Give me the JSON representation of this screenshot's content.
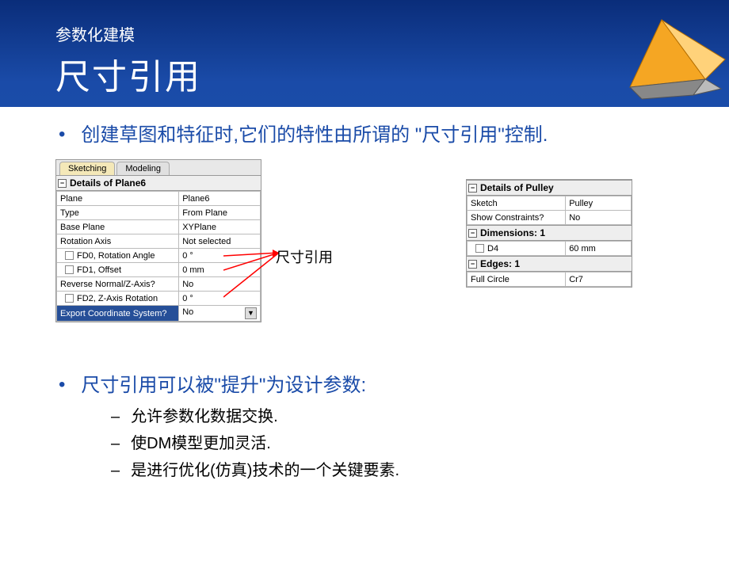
{
  "header": {
    "subtitle": "参数化建模",
    "title": "尺寸引用"
  },
  "bullets": {
    "b1": "创建草图和特征时,它们的特性由所谓的 \"尺寸引用\"控制.",
    "b2": "尺寸引用可以被\"提升\"为设计参数:",
    "sub1": "允许参数化数据交换.",
    "sub2": "使DM模型更加灵活.",
    "sub3": "是进行优化(仿真)技术的一个关键要素."
  },
  "callout": "尺寸引用",
  "panel_left": {
    "tabs": {
      "t1": "Sketching",
      "t2": "Modeling"
    },
    "header": "Details of Plane6",
    "rows": [
      {
        "label": "Plane",
        "value": "Plane6",
        "checkbox": false
      },
      {
        "label": "Type",
        "value": "From Plane",
        "checkbox": false
      },
      {
        "label": "Base Plane",
        "value": "XYPlane",
        "checkbox": false
      },
      {
        "label": "Rotation Axis",
        "value": "Not selected",
        "checkbox": false
      },
      {
        "label": "FD0, Rotation Angle",
        "value": "0 °",
        "checkbox": true
      },
      {
        "label": "FD1, Offset",
        "value": "0 mm",
        "checkbox": true
      },
      {
        "label": "Reverse Normal/Z-Axis?",
        "value": "No",
        "checkbox": false
      },
      {
        "label": "FD2, Z-Axis Rotation",
        "value": "0 °",
        "checkbox": true
      },
      {
        "label": "Export Coordinate System?",
        "value": "No",
        "checkbox": false,
        "selected": true,
        "dropdown": true
      }
    ]
  },
  "panel_right": {
    "header": "Details of Pulley",
    "sections": [
      {
        "kind": "rows",
        "rows": [
          {
            "label": "Sketch",
            "value": "Pulley"
          },
          {
            "label": "Show Constraints?",
            "value": "No"
          }
        ]
      },
      {
        "kind": "header",
        "label": "Dimensions: 1"
      },
      {
        "kind": "rows",
        "rows": [
          {
            "label": "D4",
            "value": "60 mm",
            "checkbox": true
          }
        ]
      },
      {
        "kind": "header",
        "label": "Edges: 1"
      },
      {
        "kind": "rows",
        "rows": [
          {
            "label": "Full Circle",
            "value": "Cr7"
          }
        ]
      }
    ]
  }
}
